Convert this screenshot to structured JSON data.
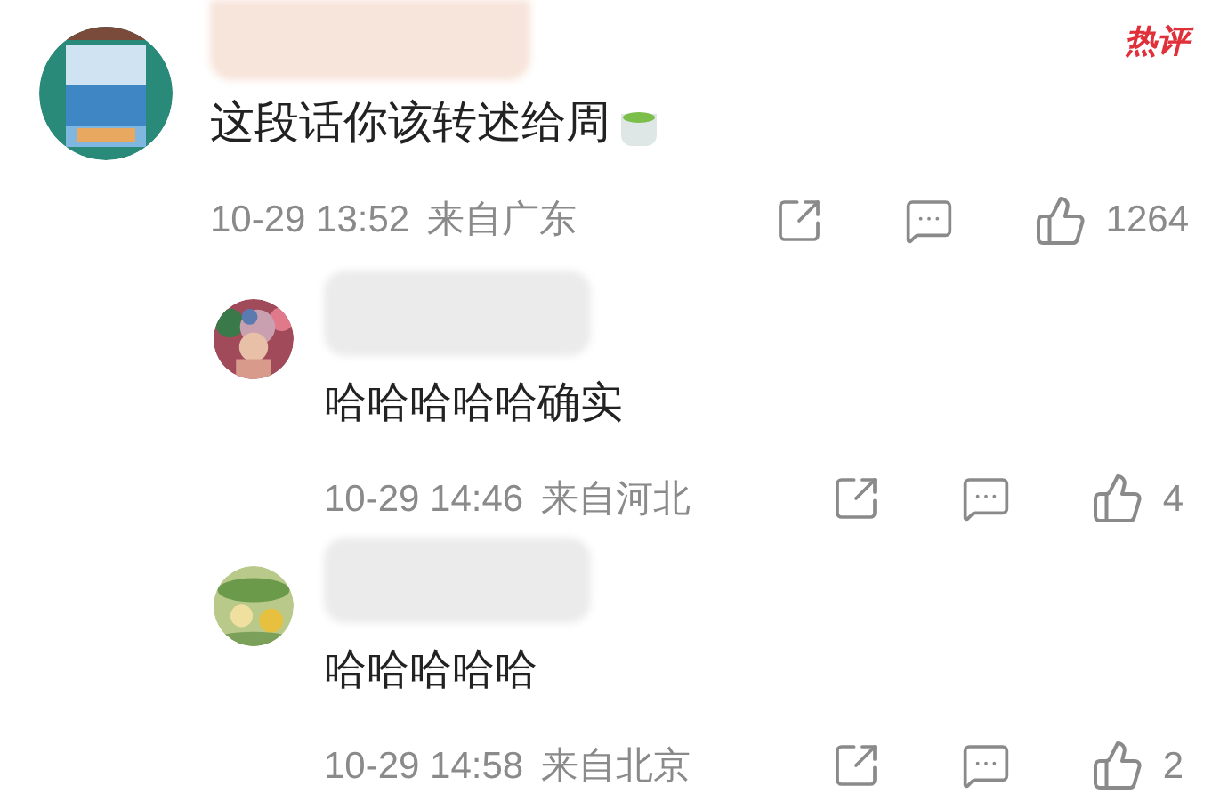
{
  "comments": [
    {
      "kind": "top",
      "hot_badge": "热评",
      "text": "这段话你该转述给周",
      "trailing_emoji": true,
      "date": "10-29 13:52",
      "location": "来自广东",
      "likes": "1264"
    },
    {
      "kind": "reply",
      "text": "哈哈哈哈哈确实",
      "trailing_emoji": false,
      "date": "10-29 14:46",
      "location": "来自河北",
      "likes": "4"
    },
    {
      "kind": "reply",
      "text": "哈哈哈哈哈",
      "trailing_emoji": false,
      "date": "10-29 14:58",
      "location": "来自北京",
      "likes": "2"
    }
  ]
}
